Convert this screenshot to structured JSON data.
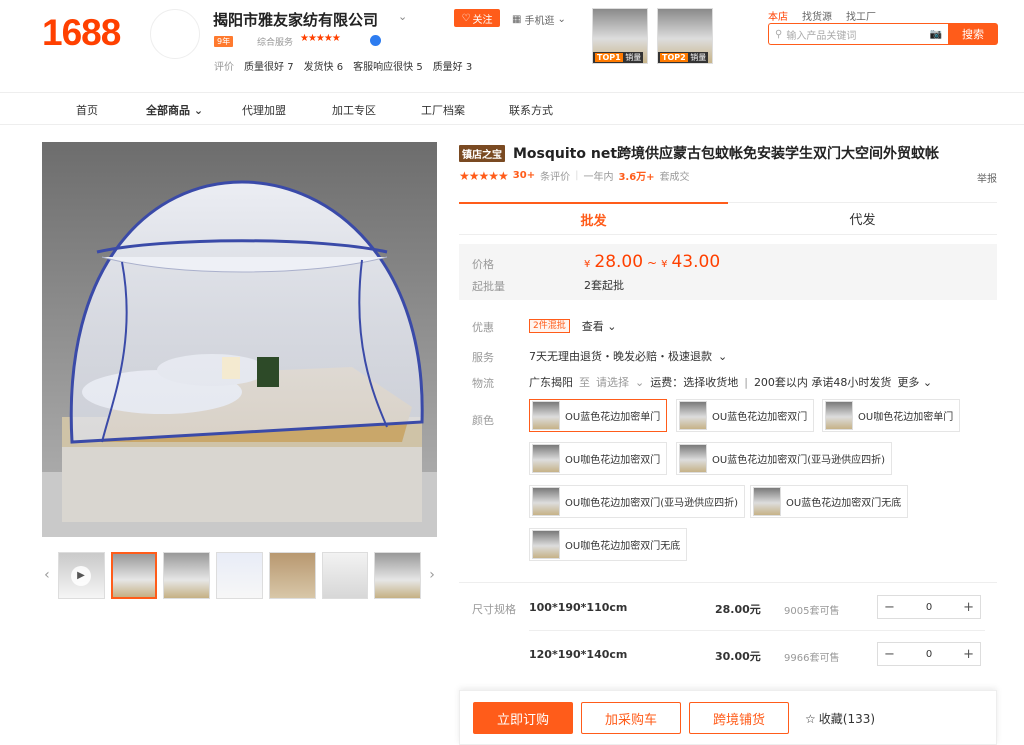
{
  "header": {
    "logo": "1688",
    "shop_name": "揭阳市雅友家纺有限公司",
    "follow": "关注",
    "mobile_shop": "手机逛",
    "year_badge": "9年",
    "service_label": "综合服务",
    "stars": "★★★★★",
    "ratings": [
      {
        "label": "评价",
        "value": ""
      },
      {
        "label": "质量很好",
        "value": "7"
      },
      {
        "label": "发货快",
        "value": "6"
      },
      {
        "label": "客服响应很快",
        "value": "5"
      },
      {
        "label": "质量好",
        "value": "3"
      }
    ],
    "top_thumbs": [
      {
        "rank": "TOP1",
        "text": "销量"
      },
      {
        "rank": "TOP2",
        "text": "销量"
      }
    ],
    "search_scopes": [
      "本店",
      "找货源",
      "找工厂"
    ],
    "search_placeholder": "输入产品关键词",
    "search_button": "搜索"
  },
  "nav": {
    "items": [
      "首页",
      "全部商品",
      "代理加盟",
      "加工专区",
      "工厂档案",
      "联系方式"
    ]
  },
  "product": {
    "store_tag": "镇店之宝",
    "title": "Mosquito net跨境供应蒙古包蚊帐免安装学生双门大空间外贸蚊帐",
    "stars": "★★★★★",
    "review_count": "30+",
    "review_label": "条评价",
    "year_label": "一年内",
    "deal_count": "3.6万+",
    "deal_label": "套成交",
    "report": "举报",
    "tabs": [
      "批发",
      "代发"
    ],
    "price_label": "价格",
    "price_low": "28.00",
    "price_high": "43.00",
    "currency": "¥",
    "price_sep": "~",
    "moq_label": "起批量",
    "moq": "2套起批",
    "promo_label": "优惠",
    "promo_tag": "2件混批",
    "promo_view": "查看",
    "service_label": "服务",
    "service": "7天无理由退货・晚发必赔・极速退款",
    "logistics_label": "物流",
    "ship_from": "广东揭阳",
    "to": "至",
    "select": "请选择",
    "freight": "运费：选择收货地",
    "ship_promise": "200套以内 承诺48小时发货",
    "more": "更多",
    "color_label": "颜色",
    "colors": [
      "OU蓝色花边加密单门",
      "OU蓝色花边加密双门",
      "OU咖色花边加密单门",
      "OU咖色花边加密双门",
      "OU蓝色花边加密双门(亚马逊供应四折)",
      "OU咖色花边加密双门(亚马逊供应四折)",
      "OU蓝色花边加密双门无底",
      "OU咖色花边加密双门无底"
    ],
    "size_label": "尺寸规格",
    "skus": [
      {
        "size": "100*190*110cm",
        "price": "28.00元",
        "stock": "9005套可售",
        "qty": "0"
      },
      {
        "size": "120*190*140cm",
        "price": "30.00元",
        "stock": "9966套可售",
        "qty": "0"
      }
    ]
  },
  "actions": {
    "buy_now": "立即订购",
    "add_cart": "加采购车",
    "cross_border": "跨境铺货",
    "favorite": "收藏(133)"
  },
  "colors": {
    "accent": "#ff5c1a",
    "logo": "#ff4000",
    "store_tag": "#7a4a22"
  }
}
